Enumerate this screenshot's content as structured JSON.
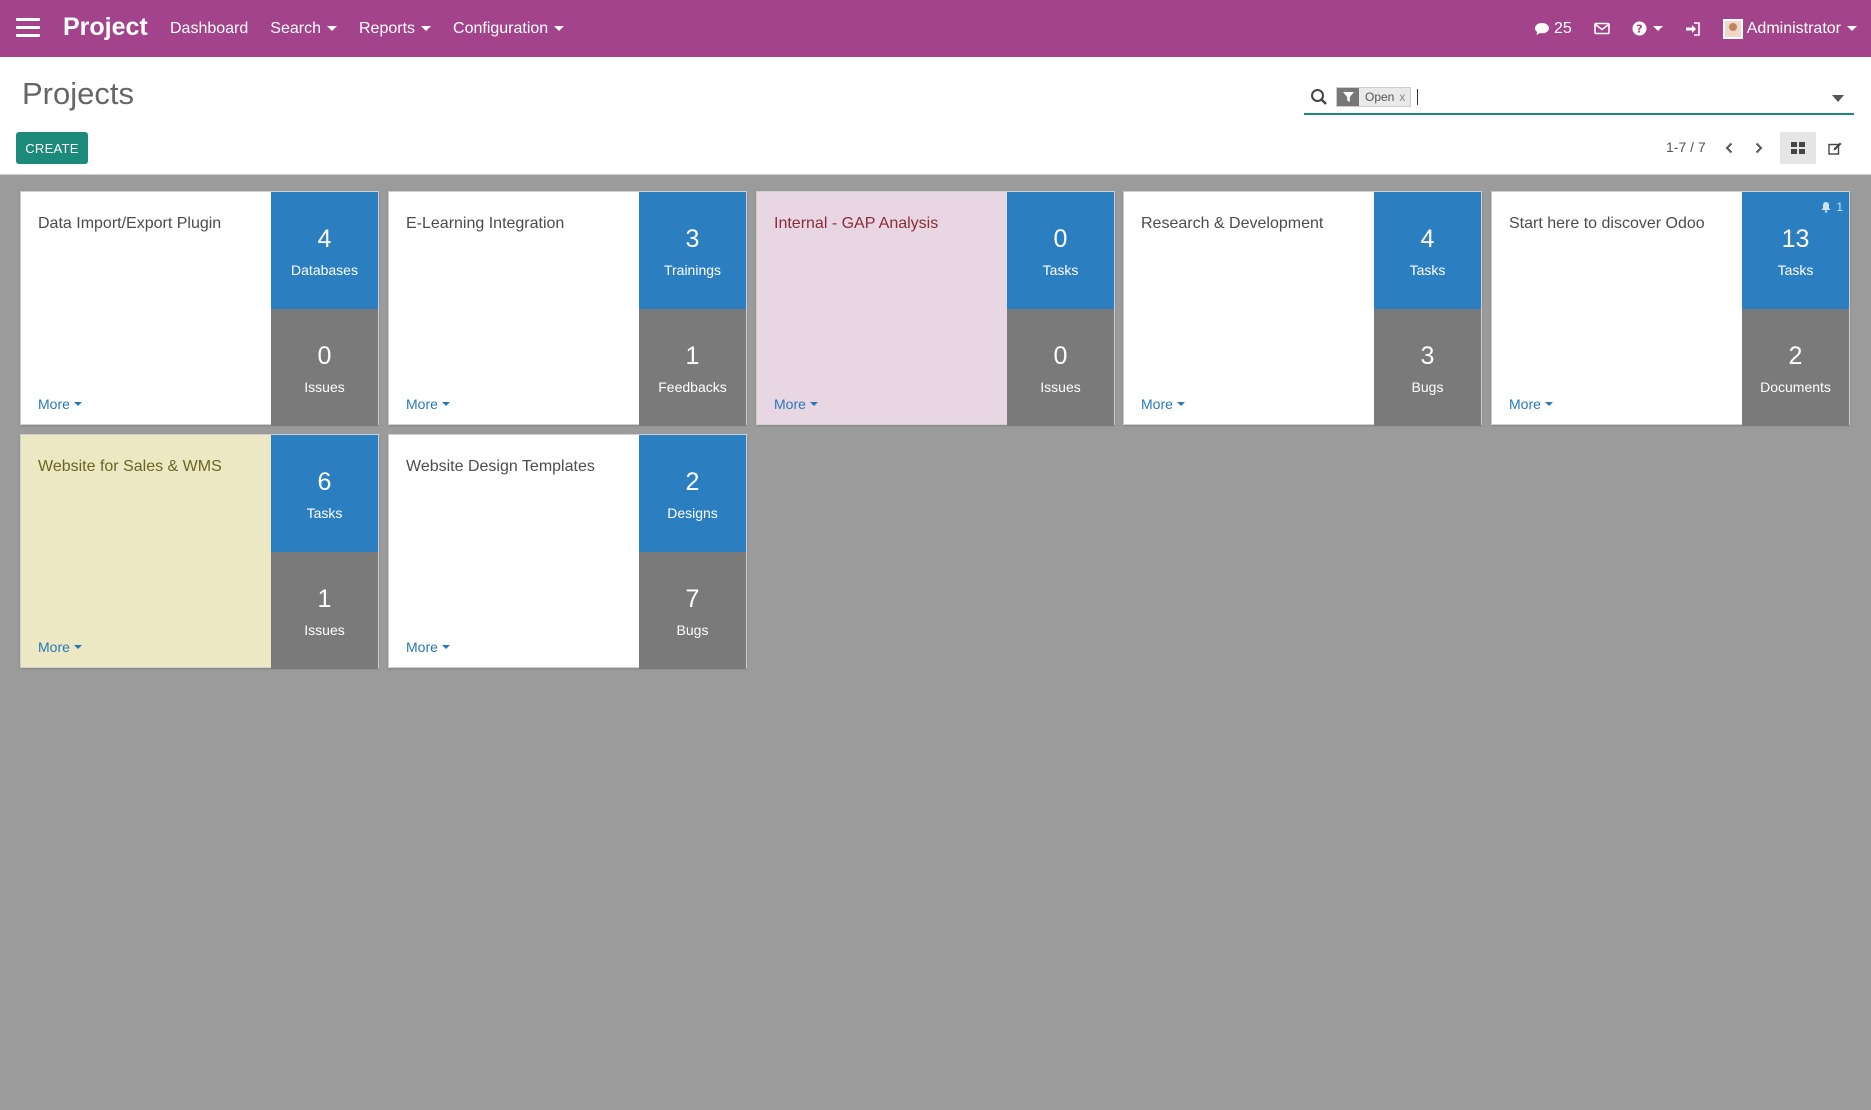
{
  "navbar": {
    "brand": "Project",
    "menu": [
      {
        "label": "Dashboard",
        "dropdown": false
      },
      {
        "label": "Search",
        "dropdown": true
      },
      {
        "label": "Reports",
        "dropdown": true
      },
      {
        "label": "Configuration",
        "dropdown": true
      }
    ],
    "messages_count": "25",
    "user_name": "Administrator",
    "color": "#a2438c"
  },
  "control_panel": {
    "title": "Projects",
    "search": {
      "facet_label": "Open",
      "facet_close": "x",
      "value": ""
    },
    "create_label": "CREATE",
    "pager": "1-7 / 7"
  },
  "projects": [
    {
      "name": "Data Import/Export Plugin",
      "color": "white",
      "more": "More",
      "top": {
        "count": "4",
        "label": "Databases"
      },
      "bottom": {
        "count": "0",
        "label": "Issues"
      }
    },
    {
      "name": "E-Learning Integration",
      "color": "white",
      "more": "More",
      "top": {
        "count": "3",
        "label": "Trainings"
      },
      "bottom": {
        "count": "1",
        "label": "Feedbacks"
      }
    },
    {
      "name": "Internal - GAP Analysis",
      "color": "pink",
      "more": "More",
      "top": {
        "count": "0",
        "label": "Tasks"
      },
      "bottom": {
        "count": "0",
        "label": "Issues"
      }
    },
    {
      "name": "Research & Development",
      "color": "white",
      "more": "More",
      "top": {
        "count": "4",
        "label": "Tasks"
      },
      "bottom": {
        "count": "3",
        "label": "Bugs"
      }
    },
    {
      "name": "Start here to discover Odoo",
      "color": "white",
      "more": "More",
      "notifications": "1",
      "top": {
        "count": "13",
        "label": "Tasks"
      },
      "bottom": {
        "count": "2",
        "label": "Documents"
      }
    },
    {
      "name": "Website for Sales & WMS",
      "color": "yellow",
      "more": "More",
      "top": {
        "count": "6",
        "label": "Tasks"
      },
      "bottom": {
        "count": "1",
        "label": "Issues"
      }
    },
    {
      "name": "Website Design Templates",
      "color": "white",
      "more": "More",
      "top": {
        "count": "2",
        "label": "Designs"
      },
      "bottom": {
        "count": "7",
        "label": "Bugs"
      }
    }
  ],
  "colors": {
    "stat_top": "#2b7fc1",
    "stat_bottom": "#7a7a7a",
    "create_button": "#1c8a7b",
    "pink_card": "#e8d7e2",
    "yellow_card": "#ece8c4"
  }
}
